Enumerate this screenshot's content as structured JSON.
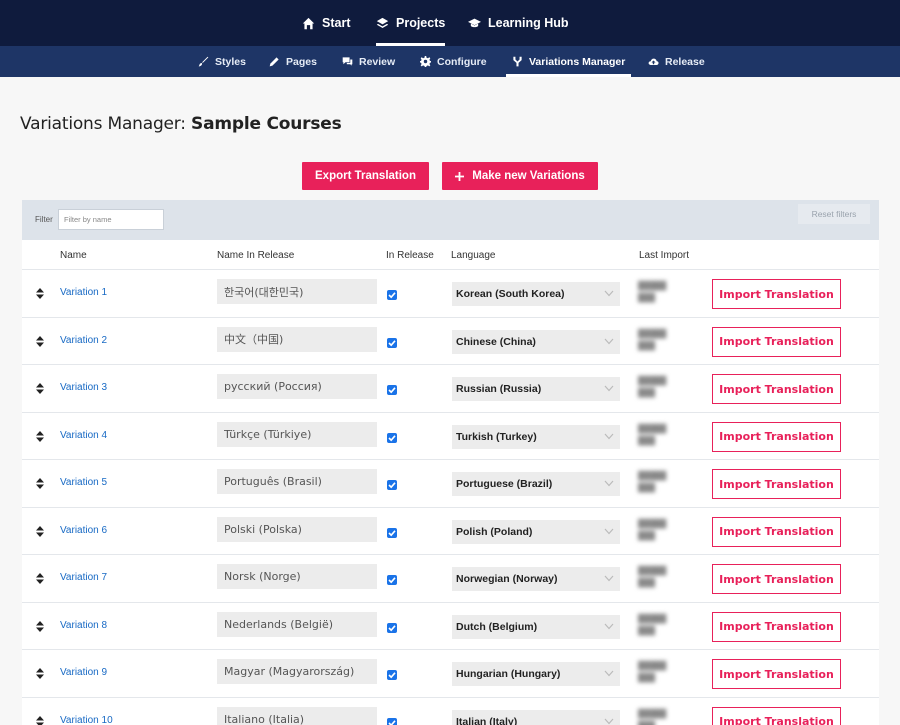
{
  "topnav": {
    "items": [
      {
        "label": "Start",
        "icon": "home-icon"
      },
      {
        "label": "Projects",
        "icon": "layers-icon",
        "active": true
      },
      {
        "label": "Learning Hub",
        "icon": "graduation-cap-icon"
      }
    ]
  },
  "subnav": {
    "items": [
      {
        "label": "Styles",
        "icon": "brush-icon"
      },
      {
        "label": "Pages",
        "icon": "pencil-icon"
      },
      {
        "label": "Review",
        "icon": "comments-icon"
      },
      {
        "label": "Configure",
        "icon": "gear-icon"
      },
      {
        "label": "Variations Manager",
        "icon": "fork-icon",
        "active": true
      },
      {
        "label": "Release",
        "icon": "cloud-upload-icon"
      }
    ]
  },
  "page": {
    "title_prefix": "Variations Manager: ",
    "title_name": "Sample Courses"
  },
  "actions": {
    "export_label": "Export Translation",
    "new_variations_label": "Make new Variations"
  },
  "filter": {
    "label": "Filter",
    "placeholder": "Filter by name",
    "reset_label": "Reset filters"
  },
  "columns": {
    "name": "Name",
    "name_in_release": "Name In Release",
    "in_release": "In Release",
    "language": "Language",
    "last_import": "Last Import"
  },
  "accent_color": "#e8215a",
  "rows": [
    {
      "name": "Variation 1",
      "release_name": "한국어(대한민국)",
      "in_release": true,
      "language": "Korean (South Korea)",
      "import_label": "Import Translation"
    },
    {
      "name": "Variation 2",
      "release_name": "中文（中国)",
      "in_release": true,
      "language": "Chinese (China)",
      "import_label": "Import Translation"
    },
    {
      "name": "Variation 3",
      "release_name": "русский (Россия)",
      "in_release": true,
      "language": "Russian (Russia)",
      "import_label": "Import Translation"
    },
    {
      "name": "Variation 4",
      "release_name": "Türkçe (Türkiye)",
      "in_release": true,
      "language": "Turkish (Turkey)",
      "import_label": "Import Translation"
    },
    {
      "name": "Variation 5",
      "release_name": "Português (Brasil)",
      "in_release": true,
      "language": "Portuguese (Brazil)",
      "import_label": "Import Translation"
    },
    {
      "name": "Variation 6",
      "release_name": "Polski (Polska)",
      "in_release": true,
      "language": "Polish (Poland)",
      "import_label": "Import Translation"
    },
    {
      "name": "Variation 7",
      "release_name": "Norsk (Norge)",
      "in_release": true,
      "language": "Norwegian (Norway)",
      "import_label": "Import Translation"
    },
    {
      "name": "Variation 8",
      "release_name": "Nederlands (België)",
      "in_release": true,
      "language": "Dutch (Belgium)",
      "import_label": "Import Translation"
    },
    {
      "name": "Variation 9",
      "release_name": "Magyar (Magyarország)",
      "in_release": true,
      "language": "Hungarian (Hungary)",
      "import_label": "Import Translation"
    },
    {
      "name": "Variation 10",
      "release_name": "Italiano (Italia)",
      "in_release": true,
      "language": "Italian (Italy)",
      "import_label": "Import Translation"
    }
  ]
}
